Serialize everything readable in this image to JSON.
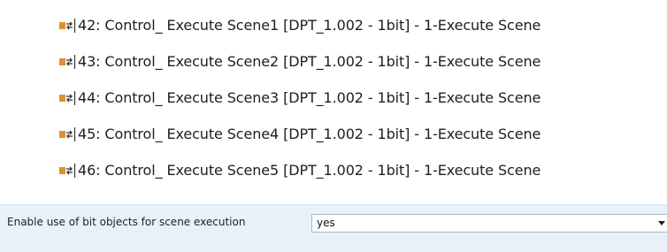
{
  "objects": [
    {
      "label": "42: Control_ Execute Scene1 [DPT_1.002 - 1bit] - 1-Execute Scene",
      "icon": "knx-communication-object-icon"
    },
    {
      "label": "43: Control_ Execute Scene2 [DPT_1.002 - 1bit] - 1-Execute Scene",
      "icon": "knx-communication-object-icon"
    },
    {
      "label": "44: Control_ Execute Scene3 [DPT_1.002 - 1bit] - 1-Execute Scene",
      "icon": "knx-communication-object-icon"
    },
    {
      "label": "45: Control_ Execute Scene4 [DPT_1.002 - 1bit] - 1-Execute Scene",
      "icon": "knx-communication-object-icon"
    },
    {
      "label": "46: Control_ Execute Scene5 [DPT_1.002 - 1bit] - 1-Execute Scene",
      "icon": "knx-communication-object-icon"
    }
  ],
  "parameter": {
    "label": "Enable use of bit objects for scene execution",
    "value": "yes"
  },
  "colors": {
    "object_icon_square": "#e0902f",
    "object_icon_arrows": "#333333",
    "parameter_row_background": "#e8f1fa"
  }
}
